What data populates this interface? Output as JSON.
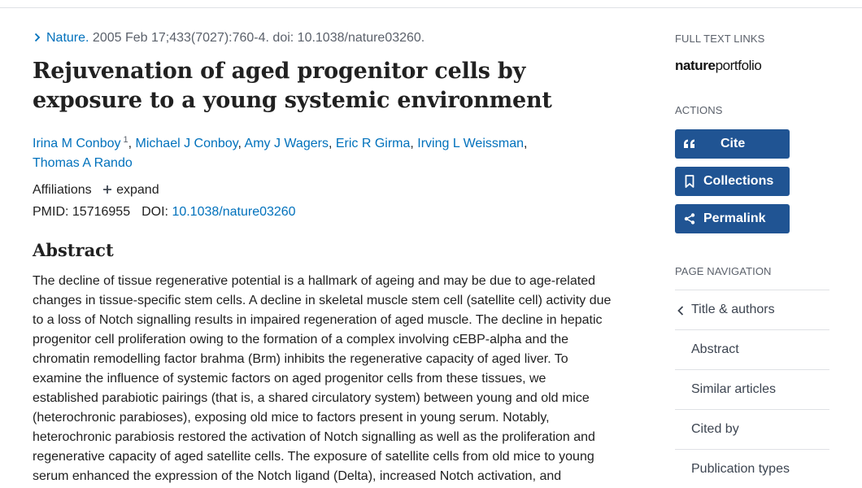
{
  "citation": {
    "journal": "Nature.",
    "details": "2005 Feb 17;433(7027):760-4. doi: 10.1038/nature03260."
  },
  "article": {
    "title": "Rejuvenation of aged progenitor cells by exposure to a young systemic environment",
    "authors": [
      {
        "name": "Irina M Conboy",
        "sup": "1"
      },
      {
        "name": "Michael J Conboy"
      },
      {
        "name": "Amy J Wagers"
      },
      {
        "name": "Eric R Girma"
      },
      {
        "name": "Irving L Weissman"
      },
      {
        "name": "Thomas A Rando"
      }
    ],
    "affiliations_label": "Affiliations",
    "expand_label": "expand",
    "pmid_label": "PMID:",
    "pmid": "15716955",
    "doi_label": "DOI:",
    "doi": "10.1038/nature03260"
  },
  "abstract": {
    "heading": "Abstract",
    "text": "The decline of tissue regenerative potential is a hallmark of ageing and may be due to age-related changes in tissue-specific stem cells. A decline in skeletal muscle stem cell (satellite cell) activity due to a loss of Notch signalling results in impaired regeneration of aged muscle. The decline in hepatic progenitor cell proliferation owing to the formation of a complex involving cEBP-alpha and the chromatin remodelling factor brahma (Brm) inhibits the regenerative capacity of aged liver. To examine the influence of systemic factors on aged progenitor cells from these tissues, we established parabiotic pairings (that is, a shared circulatory system) between young and old mice (heterochronic parabioses), exposing old mice to factors present in young serum. Notably, heterochronic parabiosis restored the activation of Notch signalling as well as the proliferation and regenerative capacity of aged satellite cells. The exposure of satellite cells from old mice to young serum enhanced the expression of the Notch ligand (Delta), increased Notch activation, and"
  },
  "sidebar": {
    "full_text_label": "FULL TEXT LINKS",
    "logo_bold": "nature",
    "logo_light": "portfolio",
    "actions_label": "ACTIONS",
    "actions": {
      "cite": "Cite",
      "collections": "Collections",
      "permalink": "Permalink"
    },
    "page_nav_label": "PAGE NAVIGATION",
    "nav": {
      "title_authors": "Title & authors",
      "abstract": "Abstract",
      "similar": "Similar articles",
      "cited_by": "Cited by",
      "pub_types": "Publication types"
    }
  },
  "colors": {
    "link": "#0071bc",
    "button": "#205493",
    "border": "#dfe1e5",
    "muted": "#5b616b"
  },
  "icons": [
    "chevron-right-icon",
    "plus-icon",
    "quote-icon",
    "bookmark-icon",
    "share-icon",
    "chevron-left-icon"
  ]
}
